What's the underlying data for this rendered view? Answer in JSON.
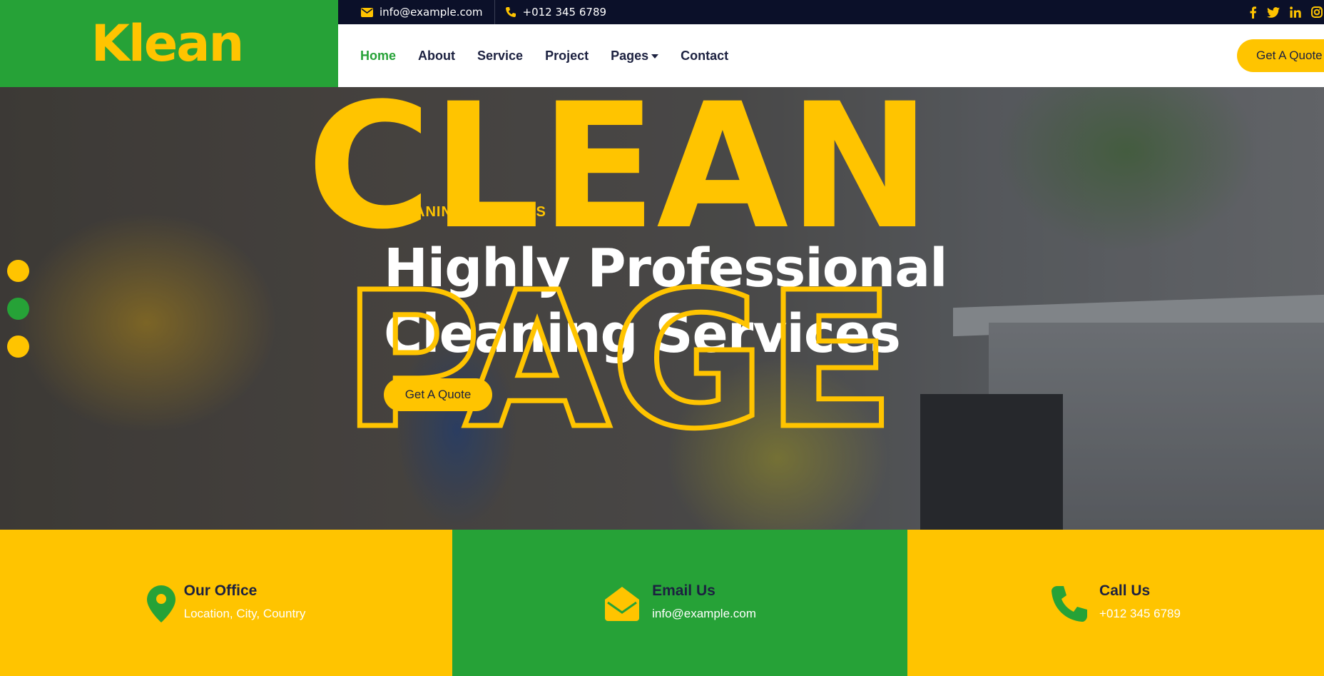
{
  "brand": {
    "logo": "Klean",
    "green": "#26a237",
    "yellow": "#ffc400",
    "navy": "#0b1029"
  },
  "topbar": {
    "email": "info@example.com",
    "phone": "+012 345 6789",
    "email_icon": "envelope-icon",
    "phone_icon": "phone-icon",
    "socials": [
      "facebook-icon",
      "twitter-icon",
      "linkedin-icon",
      "instagram-icon"
    ]
  },
  "nav": {
    "items": [
      {
        "label": "Home",
        "active": true
      },
      {
        "label": "About"
      },
      {
        "label": "Service"
      },
      {
        "label": "Project"
      },
      {
        "label": "Pages",
        "dropdown": true
      },
      {
        "label": "Contact"
      }
    ],
    "cta": "Get A Quote"
  },
  "hero": {
    "subtitle": "CLEANING SERVICES",
    "title_line1": "Highly Professional",
    "title_line2": "Cleaning Services",
    "button": "Get A Quote",
    "slides": 3,
    "active_slide": 2
  },
  "overlay": {
    "word1": "CLEAN",
    "word2": "PAGE"
  },
  "contact": [
    {
      "title": "Our Office",
      "value": "Location, City, Country",
      "icon": "map-marker-icon"
    },
    {
      "title": "Email Us",
      "value": "info@example.com",
      "icon": "envelope-open-icon"
    },
    {
      "title": "Call Us",
      "value": "+012 345 6789",
      "icon": "phone-icon"
    }
  ]
}
